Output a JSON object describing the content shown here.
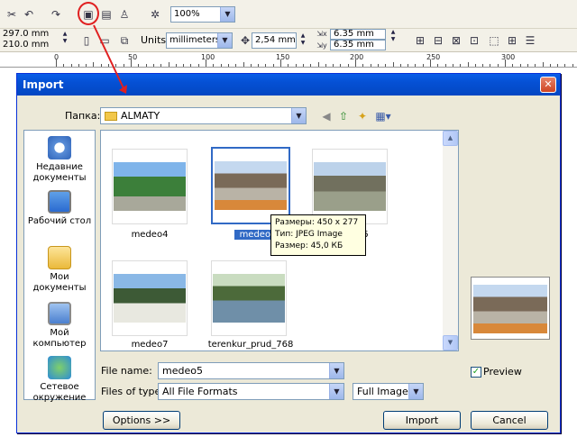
{
  "toolbar": {
    "zoom": "100%",
    "page_width": "297.0 mm",
    "page_height": "210.0 mm",
    "units_label": "Units:",
    "units_value": "millimeters",
    "nudge": "2,54 mm",
    "dup_x": "6.35 mm",
    "dup_y": "6.35 mm"
  },
  "ruler": {
    "labels": [
      "0",
      "50",
      "100",
      "150",
      "200",
      "250",
      "300"
    ]
  },
  "dialog": {
    "title": "Import",
    "folder_label": "Папка:",
    "folder_value": "ALMATY",
    "places": [
      {
        "label": "Недавние документы",
        "icon": "recent-documents-icon"
      },
      {
        "label": "Рабочий стол",
        "icon": "desktop-icon"
      },
      {
        "label": "Мои документы",
        "icon": "my-documents-icon"
      },
      {
        "label": "Мой компьютер",
        "icon": "my-computer-icon"
      },
      {
        "label": "Сетевое окружение",
        "icon": "network-icon"
      }
    ],
    "files": [
      {
        "name": "medeo4",
        "selected": false
      },
      {
        "name": "medeo5",
        "selected": true
      },
      {
        "name": "medeo6",
        "selected": false
      },
      {
        "name": "medeo7",
        "selected": false
      },
      {
        "name": "terenkur_prud_768",
        "selected": false
      }
    ],
    "tooltip": {
      "size": "Размеры: 450 x 277",
      "type": "Тип: JPEG Image",
      "filesize": "Размер: 45,0 КБ"
    },
    "file_name_label": "File name:",
    "file_name_value": "medeo5",
    "files_of_type_label": "Files of type:",
    "files_of_type_value": "All File Formats",
    "import_mode": "Full Image",
    "preview_label": "Preview",
    "preview_checked": true,
    "options_button": "Options >>",
    "import_button": "Import",
    "cancel_button": "Cancel"
  },
  "colors": {
    "accent": "#0a5ee8",
    "annotation": "#e02020",
    "selection": "#316ac5"
  }
}
